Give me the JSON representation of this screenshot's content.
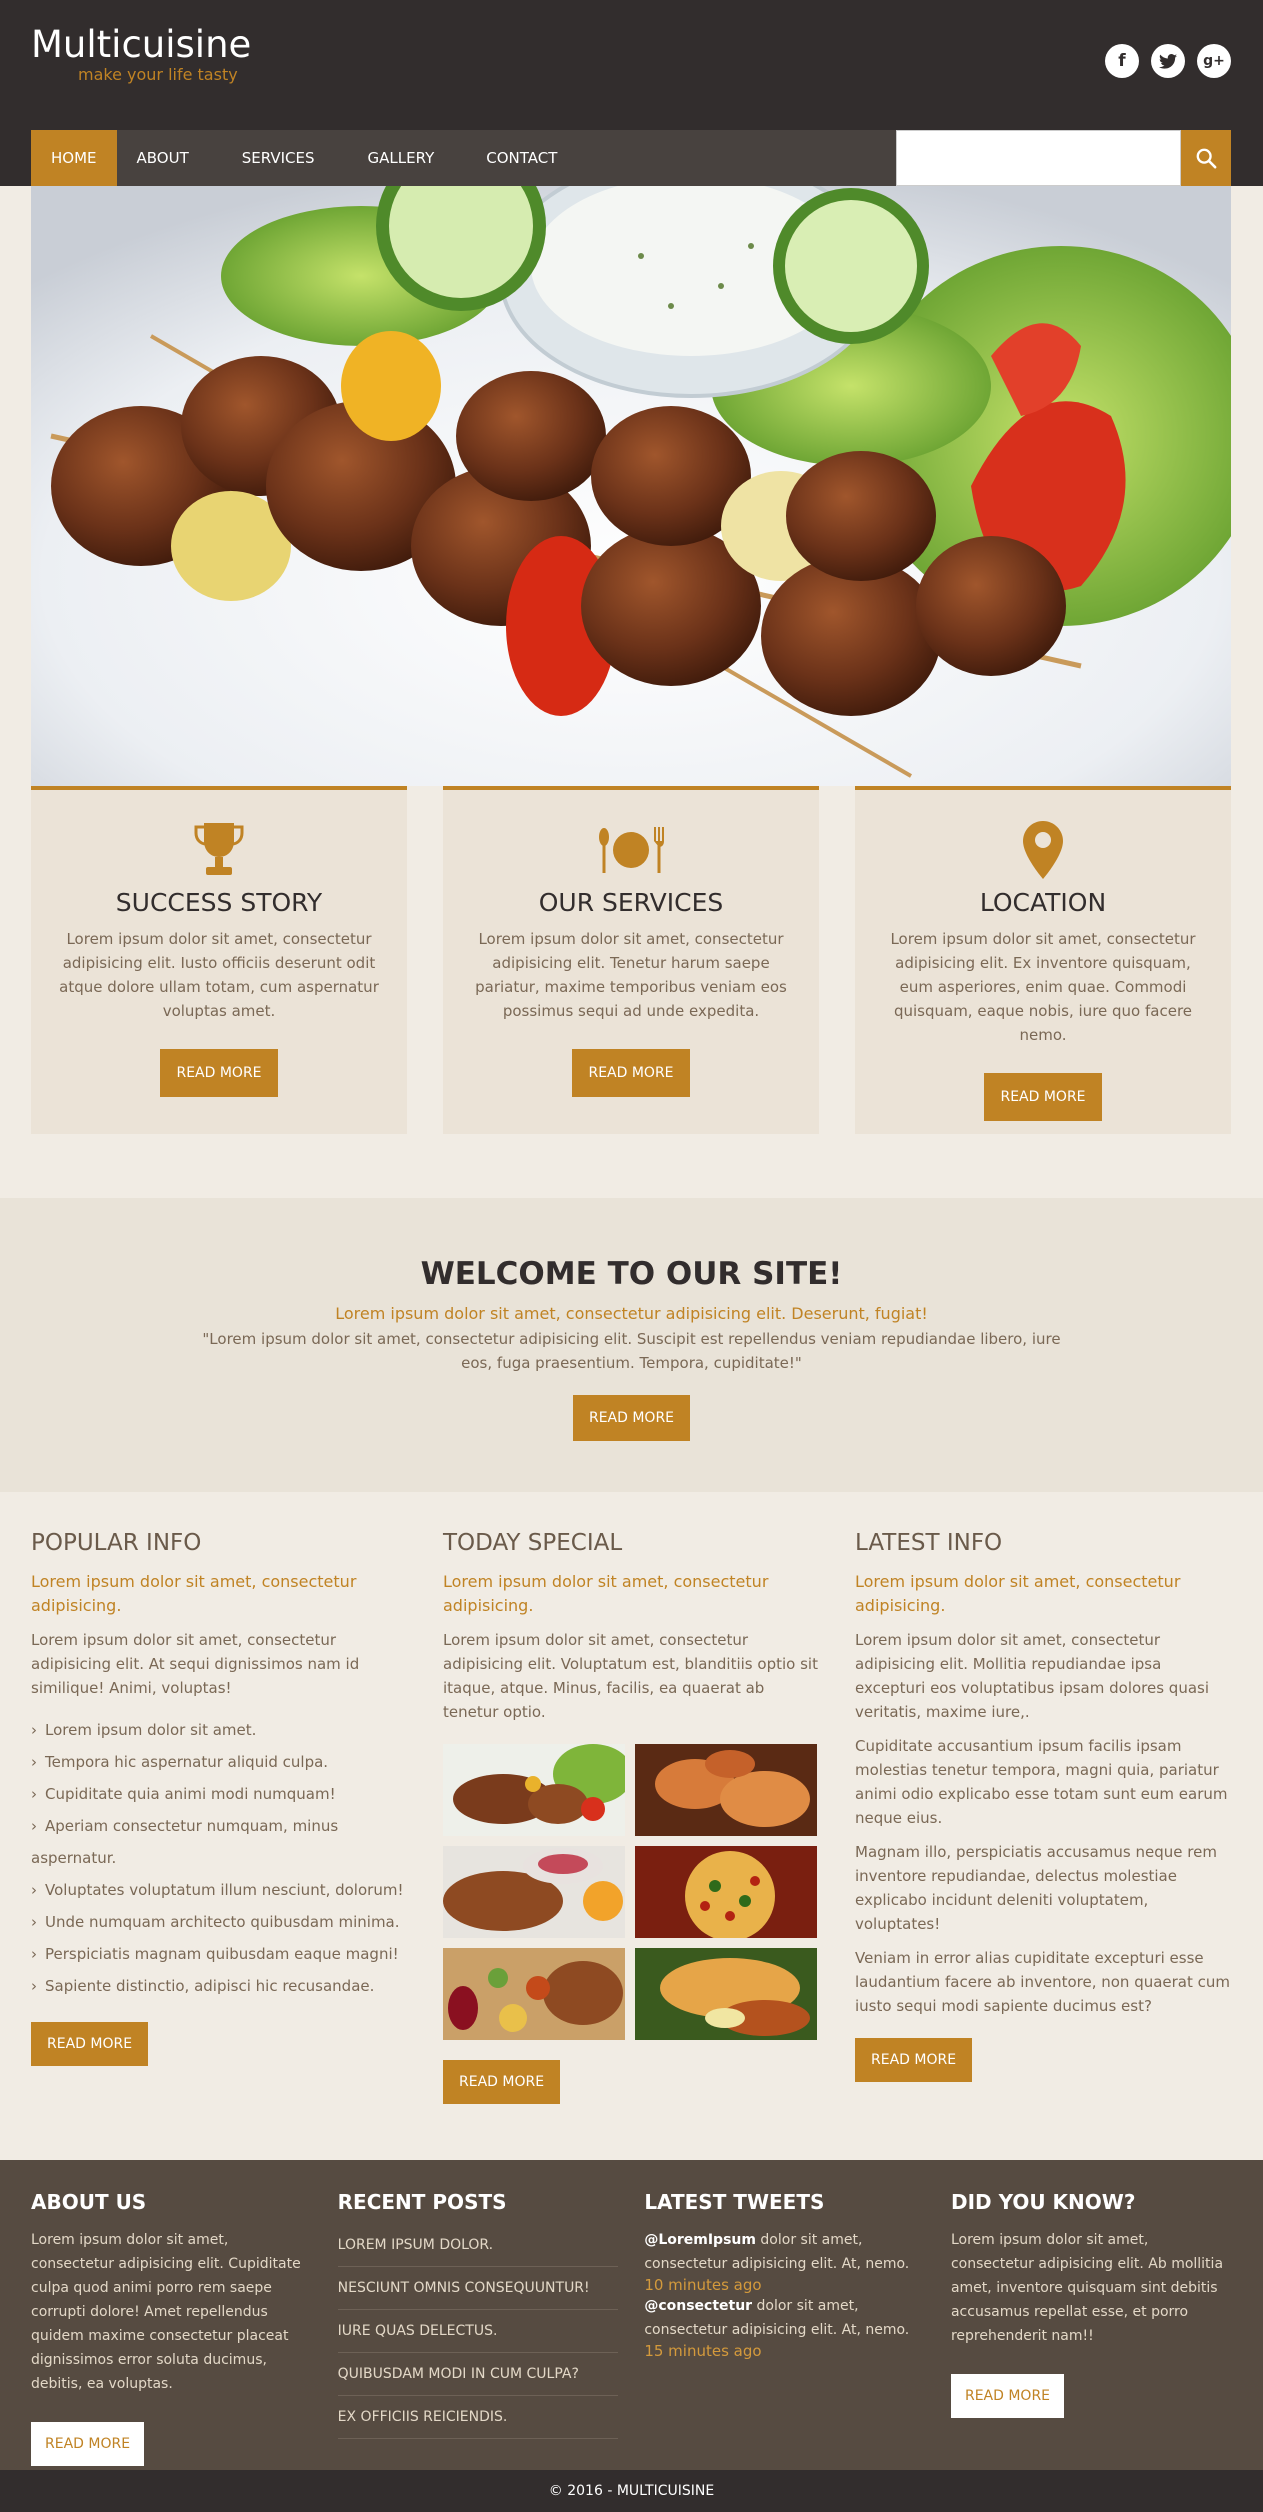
{
  "header": {
    "logo_title": "Multicuisine",
    "logo_subtitle": "make your life tasty",
    "social": [
      "facebook-icon",
      "twitter-icon",
      "google-plus-icon"
    ]
  },
  "nav": {
    "items": [
      "HOME",
      "ABOUT",
      "SERVICES",
      "GALLERY",
      "CONTACT"
    ],
    "active": "HOME",
    "search_placeholder": ""
  },
  "boxes": [
    {
      "icon": "trophy-icon",
      "title": "SUCCESS STORY",
      "text": "Lorem ipsum dolor sit amet, consectetur adipisicing elit. Iusto officiis deserunt odit atque dolore ullam totam, cum aspernatur voluptas amet.",
      "button": "READ MORE"
    },
    {
      "icon": "plate-cutlery-icon",
      "title": "OUR SERVICES",
      "text": "Lorem ipsum dolor sit amet, consectetur adipisicing elit. Tenetur harum saepe pariatur, maxime temporibus veniam eos possimus sequi ad unde expedita.",
      "button": "READ MORE"
    },
    {
      "icon": "location-pin-icon",
      "title": "LOCATION",
      "text": "Lorem ipsum dolor sit amet, consectetur adipisicing elit. Ex inventore quisquam, eum asperiores, enim quae. Commodi quisquam, eaque nobis, iure quo facere nemo.",
      "button": "READ MORE"
    }
  ],
  "welcome": {
    "title": "WELCOME TO OUR SITE!",
    "subtitle": "Lorem ipsum dolor sit amet, consectetur adipisicing elit. Deserunt, fugiat!",
    "quote": "\"Lorem ipsum dolor sit amet, consectetur adipisicing elit. Suscipit est repellendus veniam repudiandae libero, iure eos, fuga praesentium. Tempora, cupiditate!\"",
    "button": "READ MORE"
  },
  "popular": {
    "title": "POPULAR INFO",
    "lead": "Lorem ipsum dolor sit amet, consectetur adipisicing.",
    "text": "Lorem ipsum dolor sit amet, consectetur adipisicing elit. At sequi dignissimos nam id similique! Animi, voluptas!",
    "list": [
      "Lorem ipsum dolor sit amet.",
      "Tempora hic aspernatur aliquid culpa.",
      "Cupiditate quia animi modi numquam!",
      "Aperiam consectetur numquam, minus aspernatur.",
      "Voluptates voluptatum illum nesciunt, dolorum!",
      "Unde numquam architecto quibusdam minima.",
      "Perspiciatis magnam quibusdam eaque magni!",
      "Sapiente distinctio, adipisci hic recusandae."
    ],
    "button": "READ MORE"
  },
  "special": {
    "title": "TODAY SPECIAL",
    "lead": "Lorem ipsum dolor sit amet, consectetur adipisicing.",
    "text": "Lorem ipsum dolor sit amet, consectetur adipisicing elit. Voluptatum est, blanditiis optio sit itaque, atque. Minus, facilis, ea quaerat ab tenetur optio.",
    "button": "READ MORE"
  },
  "latest": {
    "title": "LATEST INFO",
    "lead": "Lorem ipsum dolor sit amet, consectetur adipisicing.",
    "paragraphs": [
      "Lorem ipsum dolor sit amet, consectetur adipisicing elit. Mollitia repudiandae ipsa excepturi eos voluptatibus ipsam dolores quasi veritatis, maxime iure,.",
      "Cupiditate accusantium ipsum facilis ipsam molestias tenetur tempora, magni quia, pariatur animi odio explicabo esse totam sunt eum earum neque eius.",
      "Magnam illo, perspiciatis accusamus neque rem inventore repudiandae, delectus molestiae explicabo incidunt deleniti voluptatem, voluptates!",
      "Veniam in error alias cupiditate excepturi esse laudantium facere ab inventore, non quaerat cum iusto sequi modi sapiente ducimus est?"
    ],
    "button": "READ MORE"
  },
  "footer": {
    "about": {
      "title": "ABOUT US",
      "text": "Lorem ipsum dolor sit amet, consectetur adipisicing elit. Cupiditate culpa quod animi porro rem saepe corrupti dolore! Amet repellendus quidem maxime consectetur placeat dignissimos error soluta ducimus, debitis, ea voluptas.",
      "button": "READ MORE"
    },
    "posts": {
      "title": "RECENT POSTS",
      "items": [
        "LOREM IPSUM DOLOR.",
        "NESCIUNT OMNIS CONSEQUUNTUR!",
        "IURE QUAS DELECTUS.",
        "QUIBUSDAM MODI IN CUM CULPA?",
        "EX OFFICIIS REICIENDIS."
      ]
    },
    "tweets": {
      "title": "LATEST TWEETS",
      "items": [
        {
          "user": "@LoremIpsum",
          "text": " dolor sit amet, consectetur adipisicing elit. At, nemo.",
          "time": "10 minutes ago"
        },
        {
          "user": "@consectetur",
          "text": " dolor sit amet, consectetur adipisicing elit. At, nemo.",
          "time": "15 minutes ago"
        }
      ]
    },
    "know": {
      "title": "DID YOU KNOW?",
      "text": "Lorem ipsum dolor sit amet, consectetur adipisicing elit. Ab mollitia amet, inventore quisquam sint debitis accusamus repellat esse, et porro reprehenderit nam!!",
      "button": "READ MORE"
    },
    "copyright": "© 2016 - MULTICUISINE"
  },
  "colors": {
    "accent": "#c08324",
    "header_bg": "#322d2d",
    "footer_bg": "#564b41",
    "page_bg": "#f1ece4"
  }
}
